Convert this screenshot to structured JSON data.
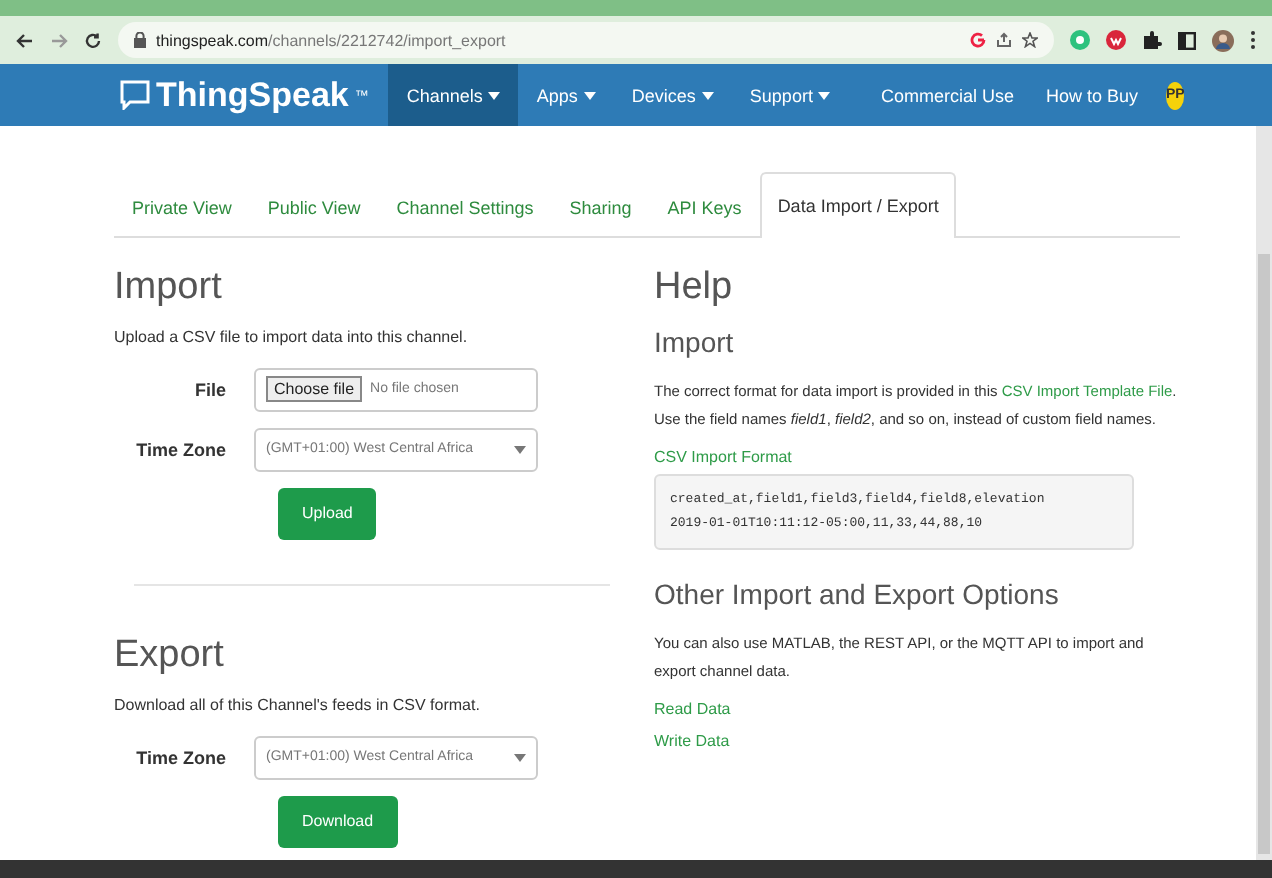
{
  "browser": {
    "url_host": "thingspeak.com",
    "url_path": "/channels/2212742/import_export"
  },
  "nav": {
    "brand": "ThingSpeak",
    "trademark": "™",
    "menus": [
      {
        "label": "Channels",
        "selected": true
      },
      {
        "label": "Apps",
        "selected": false
      },
      {
        "label": "Devices",
        "selected": false
      },
      {
        "label": "Support",
        "selected": false
      }
    ],
    "links": [
      "Commercial Use",
      "How to Buy"
    ],
    "avatar": "PP"
  },
  "tabs": [
    {
      "label": "Private View",
      "selected": false
    },
    {
      "label": "Public View",
      "selected": false
    },
    {
      "label": "Channel Settings",
      "selected": false
    },
    {
      "label": "Sharing",
      "selected": false
    },
    {
      "label": "API Keys",
      "selected": false
    },
    {
      "label": "Data Import / Export",
      "selected": true
    }
  ],
  "import": {
    "title": "Import",
    "description": "Upload a CSV file to import data into this channel.",
    "file_label": "File",
    "file_button": "Choose file",
    "file_status": "No file chosen",
    "timezone_label": "Time Zone",
    "timezone_value": "(GMT+01:00) West Central Africa",
    "button": "Upload"
  },
  "export": {
    "title": "Export",
    "description": "Download all of this Channel's feeds in CSV format.",
    "timezone_label": "Time Zone",
    "timezone_value": "(GMT+01:00) West Central Africa",
    "button": "Download"
  },
  "help": {
    "title": "Help",
    "import_title": "Import",
    "text_before": "The correct format for data import is provided in this",
    "link": "CSV Import Template File",
    "text_after": ". Use the field names *field1*, *field2*, and so on, instead of custom field names.",
    "format_title": "CSV Import Format",
    "format_lines": [
      "created_at,field1,field3,field4,field8,elevation",
      "2019-01-01T10:11:12-05:00,11,33,44,88,10"
    ],
    "other_title": "Other Import and Export Options",
    "other_text": "You can also use MATLAB, the REST API, or the MQTT API to import and export channel data.",
    "links": [
      "Read Data",
      "Write Data"
    ]
  }
}
